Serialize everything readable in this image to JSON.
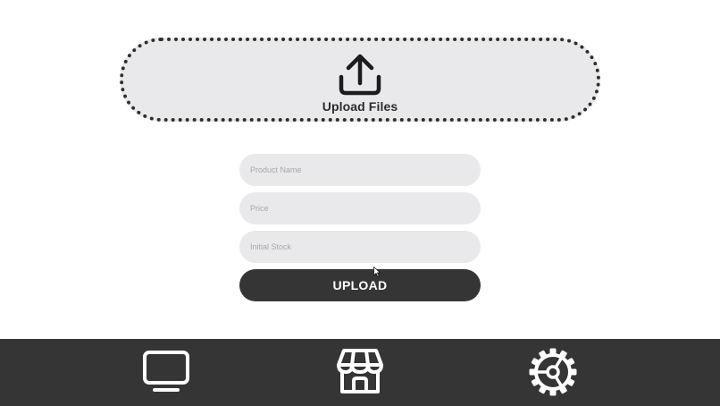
{
  "upload_area": {
    "label": "Upload Files",
    "icon": "upload-icon"
  },
  "form": {
    "product_name": {
      "placeholder": "Product Name",
      "value": ""
    },
    "price": {
      "placeholder": "Price",
      "value": ""
    },
    "initial_stock": {
      "placeholder": "Initial Stock",
      "value": ""
    },
    "submit_label": "UPLOAD"
  },
  "bottom_nav": {
    "items": [
      {
        "icon": "tv-icon"
      },
      {
        "icon": "store-icon"
      },
      {
        "icon": "settings-gear-icon"
      }
    ]
  },
  "colors": {
    "background": "#ffffff",
    "field_bg": "#e9e9eb",
    "dark": "#353535",
    "text_dark": "#2c2c2e",
    "placeholder": "#a8a8ad"
  }
}
